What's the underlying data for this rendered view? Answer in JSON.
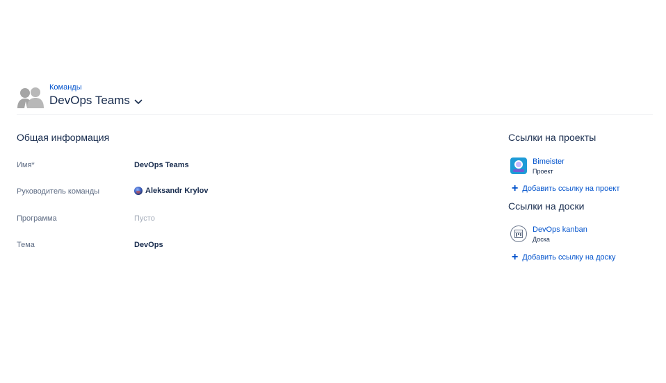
{
  "header": {
    "breadcrumb": "Команды",
    "title": "DevOps Teams"
  },
  "general": {
    "section_title": "Общая информация",
    "fields": {
      "name": {
        "label": "Имя*",
        "value": "DevOps Teams"
      },
      "lead": {
        "label": "Руководитель команды",
        "value": "Aleksandr Krylov"
      },
      "program": {
        "label": "Программа",
        "value": "Пусто"
      },
      "topic": {
        "label": "Тема",
        "value": "DevOps"
      }
    }
  },
  "project_links": {
    "section_title": "Ссылки на проекты",
    "items": [
      {
        "name": "Bimeister",
        "type": "Проект"
      }
    ],
    "add_label": "Добавить ссылку на проект"
  },
  "board_links": {
    "section_title": "Ссылки на доски",
    "items": [
      {
        "name": "DevOps kanban",
        "type": "Доска"
      }
    ],
    "add_label": "Добавить ссылку на доску"
  },
  "colors": {
    "link": "#0052cc",
    "text": "#172b4d",
    "muted": "#5e6c84",
    "empty": "#a5adba",
    "divider": "#ebecf0"
  }
}
